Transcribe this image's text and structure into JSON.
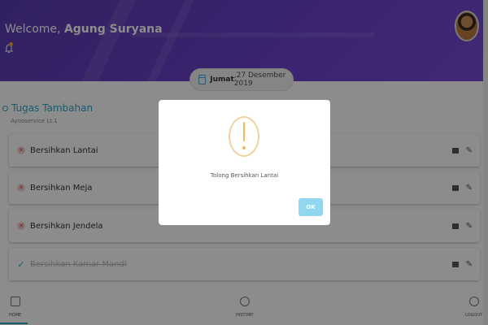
{
  "header": {
    "welcome_prefix": "Welcome,",
    "user_name": "Agung Suryana"
  },
  "date": {
    "day": "Jumat",
    "rest": " ,27 Desember 2019"
  },
  "section": {
    "title": "Tugas Tambahan",
    "subtitle": "Ayooservice Lt.1"
  },
  "tasks": [
    {
      "label": "Bersihkan Lantai",
      "status": "incomplete"
    },
    {
      "label": "Bersihkan Meja",
      "status": "incomplete"
    },
    {
      "label": "Bersihkan Jendela",
      "status": "incomplete"
    },
    {
      "label": "Bersihkan Kamar Mandi",
      "status": "done"
    }
  ],
  "modal": {
    "message": "Tolong Bersihkan Lantai",
    "ok_label": "OK"
  },
  "nav": {
    "home": "HOME",
    "history": "HISTORY",
    "logout": "LOGOUT"
  },
  "colors": {
    "header": "#6a40c8",
    "accent": "#2fa6c8",
    "warning": "#f5b55b",
    "ok_button": "#91d7f0"
  },
  "icons": [
    "bell-icon",
    "calendar-icon",
    "camera-icon",
    "pencil-icon",
    "home-icon",
    "history-icon",
    "logout-icon",
    "alert-icon"
  ]
}
